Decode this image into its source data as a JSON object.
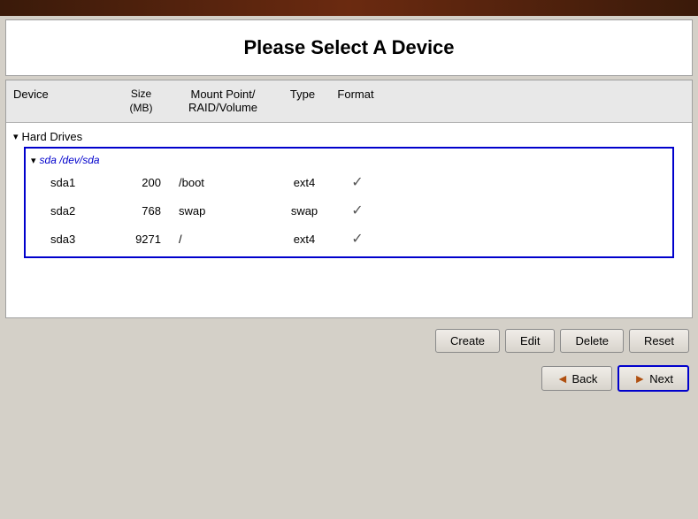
{
  "banner": {
    "visible": true
  },
  "title": "Please Select A Device",
  "table": {
    "columns": [
      {
        "key": "device",
        "label": "Device"
      },
      {
        "key": "size",
        "label": "Size\n(MB)"
      },
      {
        "key": "mount",
        "label": "Mount Point/\nRAID/Volume"
      },
      {
        "key": "type",
        "label": "Type"
      },
      {
        "key": "format",
        "label": "Format"
      }
    ],
    "groups": [
      {
        "name": "Hard Drives",
        "drives": [
          {
            "name": "sda",
            "path": "/dev/sda",
            "partitions": [
              {
                "name": "sda1",
                "size": "200",
                "mount": "/boot",
                "type": "ext4",
                "format": true
              },
              {
                "name": "sda2",
                "size": "768",
                "mount": "swap",
                "type": "swap",
                "format": true
              },
              {
                "name": "sda3",
                "size": "9271",
                "mount": "/",
                "type": "ext4",
                "format": true
              }
            ]
          }
        ]
      }
    ]
  },
  "buttons": {
    "create": "Create",
    "edit": "Edit",
    "delete": "Delete",
    "reset": "Reset",
    "back": "Back",
    "next": "Next"
  }
}
